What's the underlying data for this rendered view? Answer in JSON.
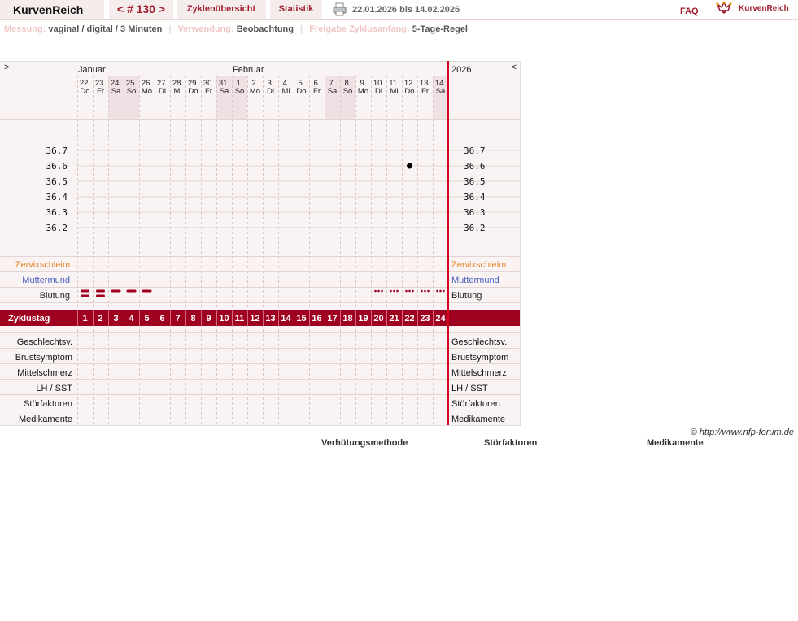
{
  "header": {
    "app_title": "KurvenReich",
    "cycle_nav": "< # 130 >",
    "tabs": [
      "Zyklenübersicht",
      "Statistik"
    ],
    "date_range": "22.01.2026 bis 14.02.2026",
    "faq": "FAQ",
    "logo_text": "KurvenReich"
  },
  "info": {
    "measure_label": "Messung:",
    "measure_value": "vaginal / digital / 3 Minuten",
    "usage_label": "Verwendung:",
    "usage_value": "Beobachtung",
    "release_label": "Freigabe Zyklusanfang:",
    "release_value": "5-Tage-Regel"
  },
  "chart": {
    "toggle_left": ">",
    "toggle_right": "<",
    "month_january": "Januar",
    "month_february": "Februar",
    "year": "2026",
    "days": [
      {
        "date": "22.",
        "wd": "Do",
        "cd": "1",
        "weekend": false
      },
      {
        "date": "23.",
        "wd": "Fr",
        "cd": "2",
        "weekend": false
      },
      {
        "date": "24.",
        "wd": "Sa",
        "cd": "3",
        "weekend": true
      },
      {
        "date": "25.",
        "wd": "So",
        "cd": "4",
        "weekend": true
      },
      {
        "date": "26.",
        "wd": "Mo",
        "cd": "5",
        "weekend": false
      },
      {
        "date": "27.",
        "wd": "Di",
        "cd": "6",
        "weekend": false
      },
      {
        "date": "28.",
        "wd": "Mi",
        "cd": "7",
        "weekend": false
      },
      {
        "date": "29.",
        "wd": "Do",
        "cd": "8",
        "weekend": false
      },
      {
        "date": "30.",
        "wd": "Fr",
        "cd": "9",
        "weekend": false
      },
      {
        "date": "31.",
        "wd": "Sa",
        "cd": "10",
        "weekend": true
      },
      {
        "date": "1.",
        "wd": "So",
        "cd": "11",
        "weekend": true
      },
      {
        "date": "2.",
        "wd": "Mo",
        "cd": "12",
        "weekend": false
      },
      {
        "date": "3.",
        "wd": "Di",
        "cd": "13",
        "weekend": false
      },
      {
        "date": "4.",
        "wd": "Mi",
        "cd": "14",
        "weekend": false
      },
      {
        "date": "5.",
        "wd": "Do",
        "cd": "15",
        "weekend": false
      },
      {
        "date": "6.",
        "wd": "Fr",
        "cd": "16",
        "weekend": false
      },
      {
        "date": "7.",
        "wd": "Sa",
        "cd": "17",
        "weekend": true
      },
      {
        "date": "8.",
        "wd": "So",
        "cd": "18",
        "weekend": true
      },
      {
        "date": "9.",
        "wd": "Mo",
        "cd": "19",
        "weekend": false
      },
      {
        "date": "10.",
        "wd": "Di",
        "cd": "20",
        "weekend": false
      },
      {
        "date": "11.",
        "wd": "Mi",
        "cd": "21",
        "weekend": false
      },
      {
        "date": "12.",
        "wd": "Do",
        "cd": "22",
        "weekend": false
      },
      {
        "date": "13.",
        "wd": "Fr",
        "cd": "23",
        "weekend": false
      },
      {
        "date": "14.",
        "wd": "Sa",
        "cd": "24",
        "weekend": true
      }
    ],
    "temp_ticks": [
      "36.7",
      "36.6",
      "36.5",
      "36.4",
      "36.3",
      "36.2"
    ],
    "temperatures": [
      {
        "cycle_day": 22,
        "value": 36.6
      }
    ],
    "rows_upper": [
      {
        "label": "Zervixschleim",
        "color": "#e8821e"
      },
      {
        "label": "Muttermund",
        "color": "#4a5fc1"
      },
      {
        "label": "Blutung",
        "color": "#222222"
      }
    ],
    "bleeding": [
      {
        "cycle_day": 1,
        "kind": "heavy"
      },
      {
        "cycle_day": 2,
        "kind": "heavy"
      },
      {
        "cycle_day": 3,
        "kind": "normal"
      },
      {
        "cycle_day": 4,
        "kind": "normal"
      },
      {
        "cycle_day": 5,
        "kind": "normal"
      },
      {
        "cycle_day": 20,
        "kind": "spotting"
      },
      {
        "cycle_day": 21,
        "kind": "spotting"
      },
      {
        "cycle_day": 22,
        "kind": "spotting"
      },
      {
        "cycle_day": 23,
        "kind": "spotting"
      },
      {
        "cycle_day": 24,
        "kind": "spotting"
      }
    ],
    "cycleday_label": "Zyklustag",
    "rows_lower": [
      "Geschlechtsv.",
      "Brustsymptom",
      "Mittelschmerz",
      "LH / SST",
      "Störfaktoren",
      "Medikamente"
    ],
    "colors": {
      "accent": "#a00020",
      "bg": "#f9f3f3",
      "weekend": "#f1e0e3",
      "grid": "#e2d5d5"
    }
  },
  "footer": {
    "copyright": "© http://www.nfp-forum.de",
    "legend": [
      "Verhütungsmethode",
      "Störfaktoren",
      "Medikamente"
    ]
  }
}
